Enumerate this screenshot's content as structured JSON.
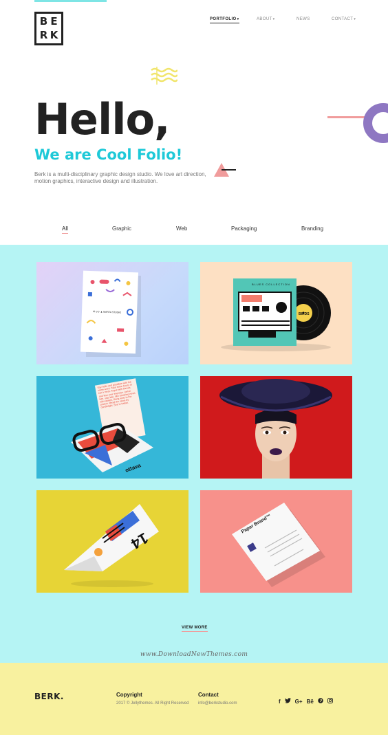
{
  "brand": {
    "logo_letters": [
      "B",
      "E",
      "R",
      "K"
    ]
  },
  "nav": {
    "items": [
      {
        "label": "PORTFOLIO",
        "caret": "▾",
        "active": true
      },
      {
        "label": "ABOUT",
        "caret": "▾",
        "active": false
      },
      {
        "label": "NEWS",
        "caret": "",
        "active": false
      },
      {
        "label": "CONTACT",
        "caret": "▾",
        "active": false
      }
    ]
  },
  "hero": {
    "title": "Hello,",
    "subtitle": "We are Cool Folio!",
    "description": "Berk is a multi-disciplinary graphic design studio. We love art direction, motion graphics, interactive design and illustration."
  },
  "filters": {
    "items": [
      "All",
      "Graphic",
      "Web",
      "Packaging",
      "Branding"
    ],
    "active": "All"
  },
  "portfolio": {
    "cards": [
      {
        "kind": "stationery-card",
        "background": "#c9d8fb",
        "card_text": "M  ⊙⊙ ▲  MARTA STUDIO"
      },
      {
        "kind": "vinyl-record",
        "background": "#fde0c3",
        "sleeve_title": "BLUES COLLECTION",
        "label_text": "BIRDS"
      },
      {
        "kind": "glasses-flyer",
        "background": "#35b7d8",
        "flyer_text": "Say hello and goodbye with the same word. Take three hours to eat a meal. Argue with friends and kiss your enemies. Arrive late, stay late. Mix breaking news with taboos. Bring wine to the protest. Read the news by candlelight. See in Italian.",
        "ottava_text": "ottava"
      },
      {
        "kind": "portrait",
        "background": "#d01a1c"
      },
      {
        "kind": "folded-paper",
        "background": "#e7d436",
        "big_text": "14"
      },
      {
        "kind": "letterhead",
        "background": "#f7918b",
        "paper_title": "Paper Brand™"
      }
    ],
    "view_more": "VIEW MORE"
  },
  "watermark": "www.DownloadNewThemes.com",
  "footer": {
    "brand": "BERK.",
    "copyright_title": "Copyright",
    "copyright_text": "2017 © Jellythemes. All Right Reserved",
    "contact_title": "Contact",
    "contact_email": "info@berkstudio.com",
    "socials": [
      {
        "name": "facebook-icon",
        "glyph": "f"
      },
      {
        "name": "twitter-icon",
        "glyph": "🐦"
      },
      {
        "name": "google-plus-icon",
        "glyph": "G+"
      },
      {
        "name": "behance-icon",
        "glyph": "Bē"
      },
      {
        "name": "pinterest-icon",
        "glyph": "℗"
      },
      {
        "name": "instagram-icon",
        "glyph": "◎"
      }
    ]
  },
  "colors": {
    "accent_cyan": "#1ec9d8",
    "portfolio_bg": "#b5f4f4",
    "footer_bg": "#f8f19f",
    "pink": "#f09c9c",
    "purple": "#8e77c2"
  }
}
